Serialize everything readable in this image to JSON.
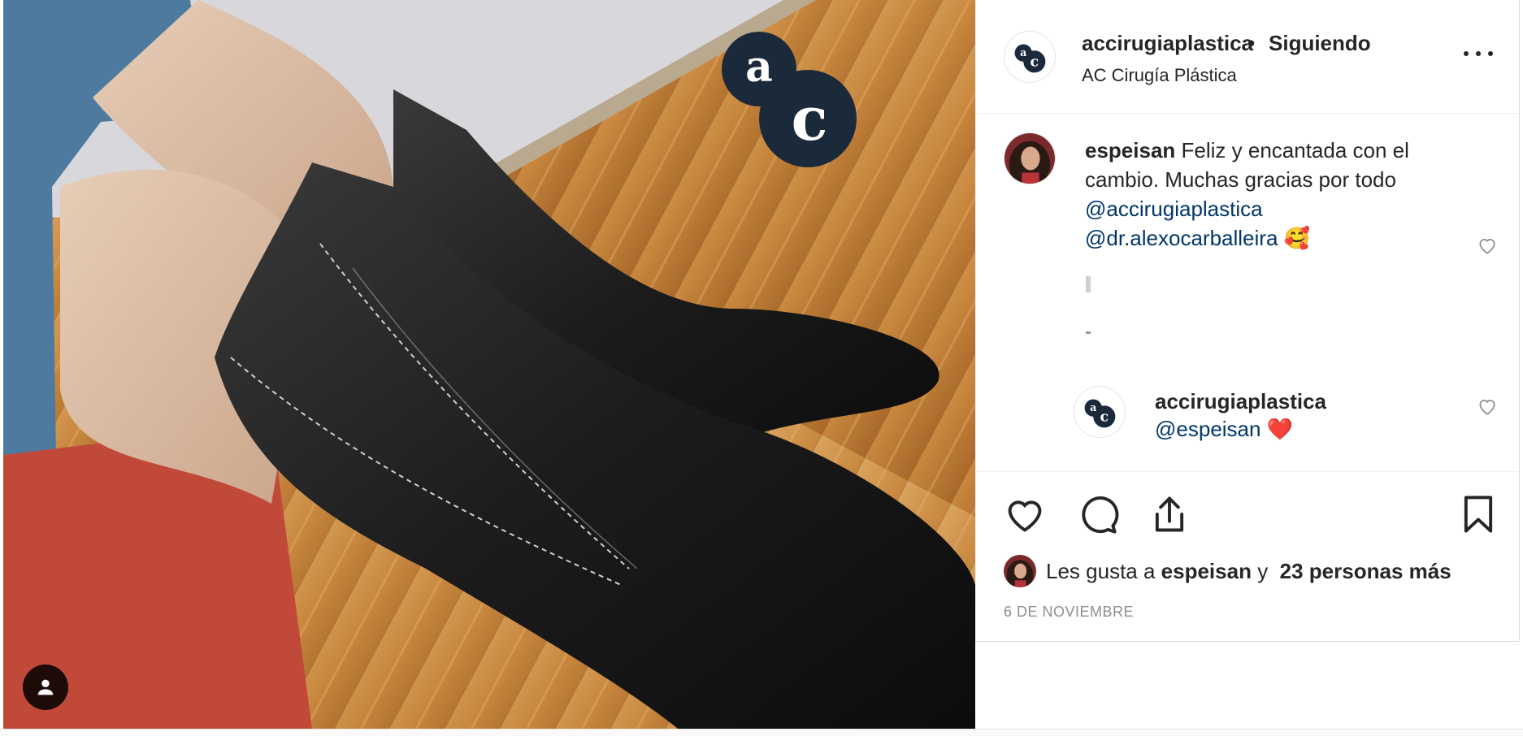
{
  "post": {
    "author_username": "accirugiaplastica",
    "follow_status": "Siguiendo",
    "separator": "•",
    "author_fullname": "AC Cirugía Plástica",
    "logo_letters": [
      "a",
      "c"
    ]
  },
  "caption": {
    "username": "espeisan",
    "text": "Feliz y encantada con el cambio. Muchas gracias por todo",
    "mentions": [
      "@accirugiaplastica",
      "@dr.alexocarballeira"
    ],
    "emoji": "🥰"
  },
  "reply": {
    "username": "accirugiaplastica",
    "mention": "@espeisan",
    "emoji": "❤️"
  },
  "likes": {
    "prefix": "Les gusta a",
    "user": "espeisan",
    "conjunction": "y",
    "others": "23 personas más"
  },
  "date": "6 DE NOVIEMBRE",
  "icons": {
    "like": "heart-icon",
    "comment": "comment-bubble-icon",
    "share": "share-icon",
    "save": "bookmark-icon",
    "more": "more-options-icon",
    "tag": "user-tag-icon"
  },
  "colors": {
    "text": "#262626",
    "link": "#00376b",
    "muted": "#8e8e8e",
    "logo_navy": "#1b2a3b",
    "heart_red": "#ed4956"
  }
}
